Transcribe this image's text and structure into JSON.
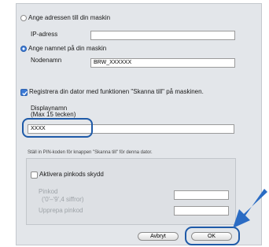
{
  "dialog": {
    "radio_address_label": "Ange adressen till din maskin",
    "ip_label": "IP-adress",
    "ip_value": "",
    "radio_name_label": "Ange namnet på din maskin",
    "node_label": "Nodenamn",
    "node_value": "BRW_XXXXXX",
    "register_checkbox_label": "Registrera din dator med funktionen \"Skanna till\" på maskinen.",
    "display_name_label": "Displaynamn",
    "display_name_hint": "(Max 15 tecken)",
    "display_name_value": "XXXX",
    "pin_instructions": "Ställ in PIN-koden för knappen \"Skanna till\" för denna dator.",
    "pin_checkbox_label": "Aktivera pinkods skydd",
    "pin_label": "Pinkod",
    "pin_hint": "('0'–'9',4 siffror)",
    "pin_value": "",
    "repeat_pin_label": "Upprepa pinkod",
    "repeat_pin_value": "",
    "cancel_label": "Avbryt",
    "ok_label": "OK"
  },
  "state": {
    "address_selected": false,
    "name_selected": true,
    "register_checked": true,
    "pin_protection_checked": false
  },
  "colors": {
    "panel_bg": "#e3e6ea",
    "highlight": "#1e5aa8",
    "pointer_arrow": "#2b6cc4"
  }
}
